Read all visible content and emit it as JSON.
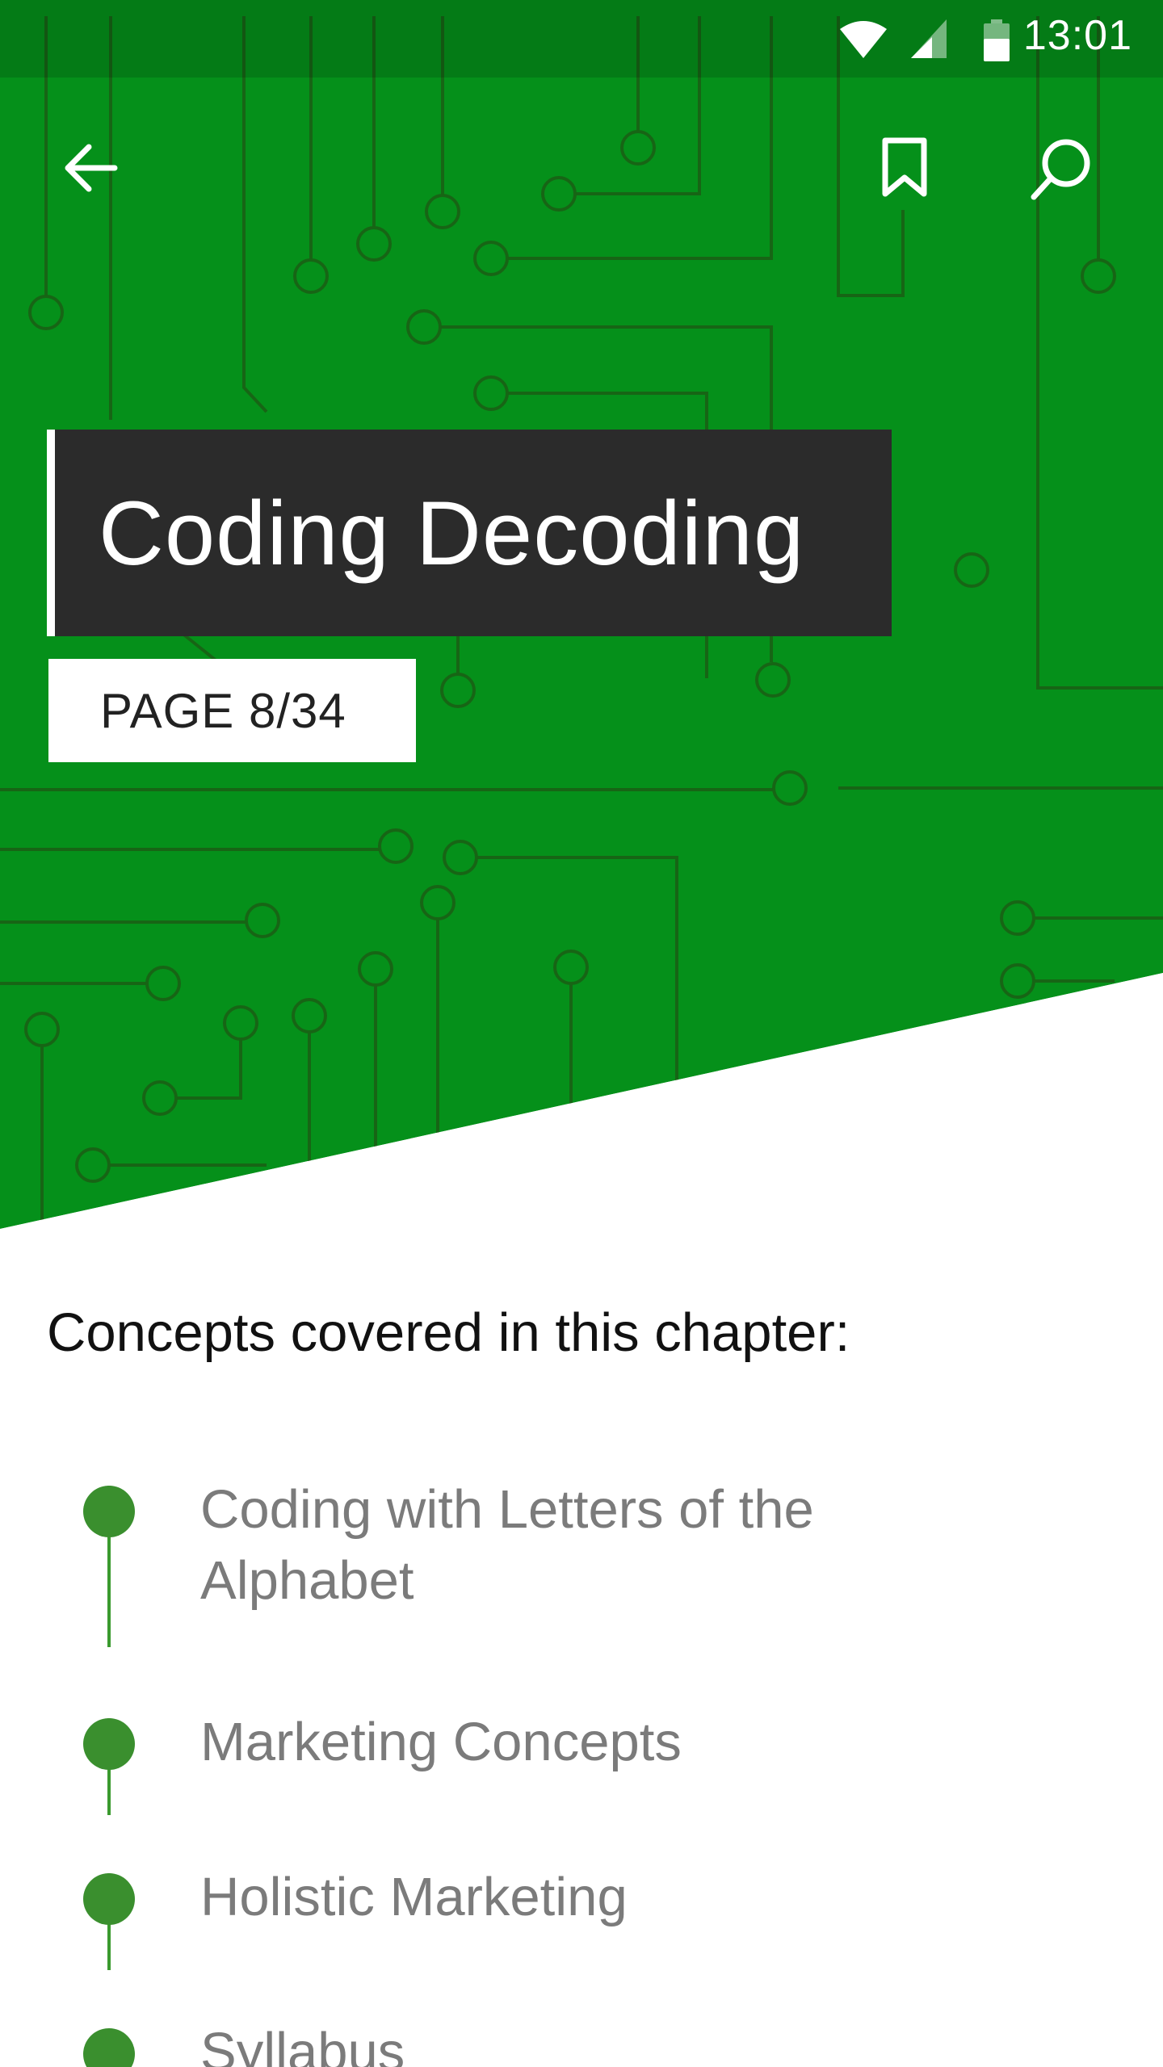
{
  "colors": {
    "hero_green": "#05901a",
    "circuit_line": "#1b5e15",
    "title_bg": "#2b2b2b",
    "timeline_dot": "#3a8f2e",
    "concept_text": "#7b7b7b"
  },
  "status_bar": {
    "time": "13:01",
    "icons": [
      "wifi-icon",
      "cell-signal-icon",
      "battery-icon"
    ]
  },
  "app_bar": {
    "back_icon": "arrow-left-icon",
    "bookmark_icon": "bookmark-icon",
    "search_icon": "search-icon"
  },
  "chapter": {
    "title": "Coding Decoding",
    "page_label": "PAGE 8/34"
  },
  "concepts": {
    "heading": "Concepts covered in this chapter:",
    "items": [
      "Coding with Letters of the Alphabet",
      "Marketing Concepts",
      "Holistic Marketing",
      "Syllabus"
    ]
  }
}
